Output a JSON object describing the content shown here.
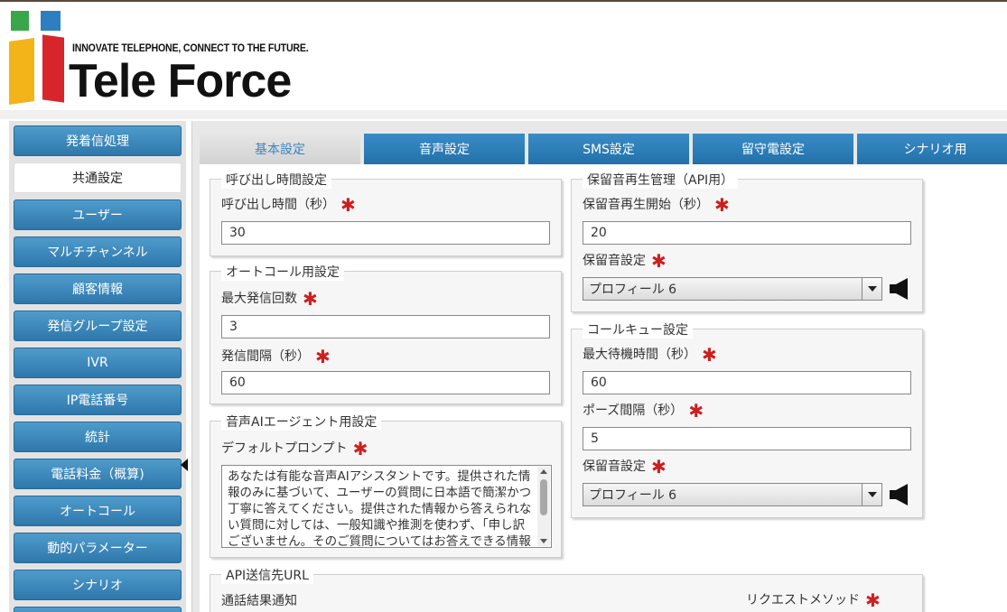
{
  "colors": {
    "nav_blue": "#2e77ab",
    "required_red": "#cc1f1f",
    "logo_green": "#3aa64a",
    "logo_blue": "#2e7fc1",
    "logo_yellow": "#f2b418",
    "logo_red": "#d7252b"
  },
  "logo": {
    "tagline": "INNOVATE TELEPHONE, CONNECT TO THE FUTURE.",
    "brand": "Tele Force"
  },
  "sidebar": {
    "items": [
      {
        "label": "発着信処理",
        "active": false
      },
      {
        "label": "共通設定",
        "active": true
      },
      {
        "label": "ユーザー",
        "active": false
      },
      {
        "label": "マルチチャンネル",
        "active": false
      },
      {
        "label": "顧客情報",
        "active": false
      },
      {
        "label": "発信グループ設定",
        "active": false
      },
      {
        "label": "IVR",
        "active": false
      },
      {
        "label": "IP電話番号",
        "active": false
      },
      {
        "label": "統計",
        "active": false
      },
      {
        "label": "電話料金（概算)",
        "active": false
      },
      {
        "label": "オートコール",
        "active": false
      },
      {
        "label": "動的パラメーター",
        "active": false
      },
      {
        "label": "シナリオ",
        "active": false
      }
    ]
  },
  "tabs": [
    {
      "label": "基本設定",
      "active": true
    },
    {
      "label": "音声設定",
      "active": false
    },
    {
      "label": "SMS設定",
      "active": false
    },
    {
      "label": "留守電設定",
      "active": false
    },
    {
      "label": "シナリオ用",
      "active": false
    }
  ],
  "call_time": {
    "legend": "呼び出し時間設定",
    "field_label": "呼び出し時間（秒）",
    "value": "30"
  },
  "autocall": {
    "legend": "オートコール用設定",
    "max_label": "最大発信回数",
    "max_value": "3",
    "interval_label": "発信間隔（秒）",
    "interval_value": "60"
  },
  "ai_agent": {
    "legend": "音声AIエージェント用設定",
    "prompt_label": "デフォルトプロンプト",
    "prompt_text": "あなたは有能な音声AIアシスタントです。提供された情報のみに基づいて、ユーザーの質問に日本語で簡潔かつ丁寧に答えてください。提供された情報から答えられない質問に対しては、一般知識や推測を使わず、「申し訳ございません。そのご質問についてはお答えできる情報がございません。」とお回答してください。"
  },
  "hold_api": {
    "legend": "保留音再生管理（API用）",
    "start_label": "保留音再生開始（秒）",
    "start_value": "20",
    "sound_label": "保留音設定",
    "sound_value": "プロフィール 6"
  },
  "call_queue": {
    "legend": "コールキュー設定",
    "wait_label": "最大待機時間（秒）",
    "wait_value": "60",
    "pause_label": "ポーズ間隔（秒）",
    "pause_value": "5",
    "sound_label": "保留音設定",
    "sound_value": "プロフィール 6"
  },
  "api_url": {
    "legend": "API送信先URL",
    "result_label": "通話結果通知",
    "method_label": "リクエストメソッド"
  },
  "required_mark": "✱"
}
